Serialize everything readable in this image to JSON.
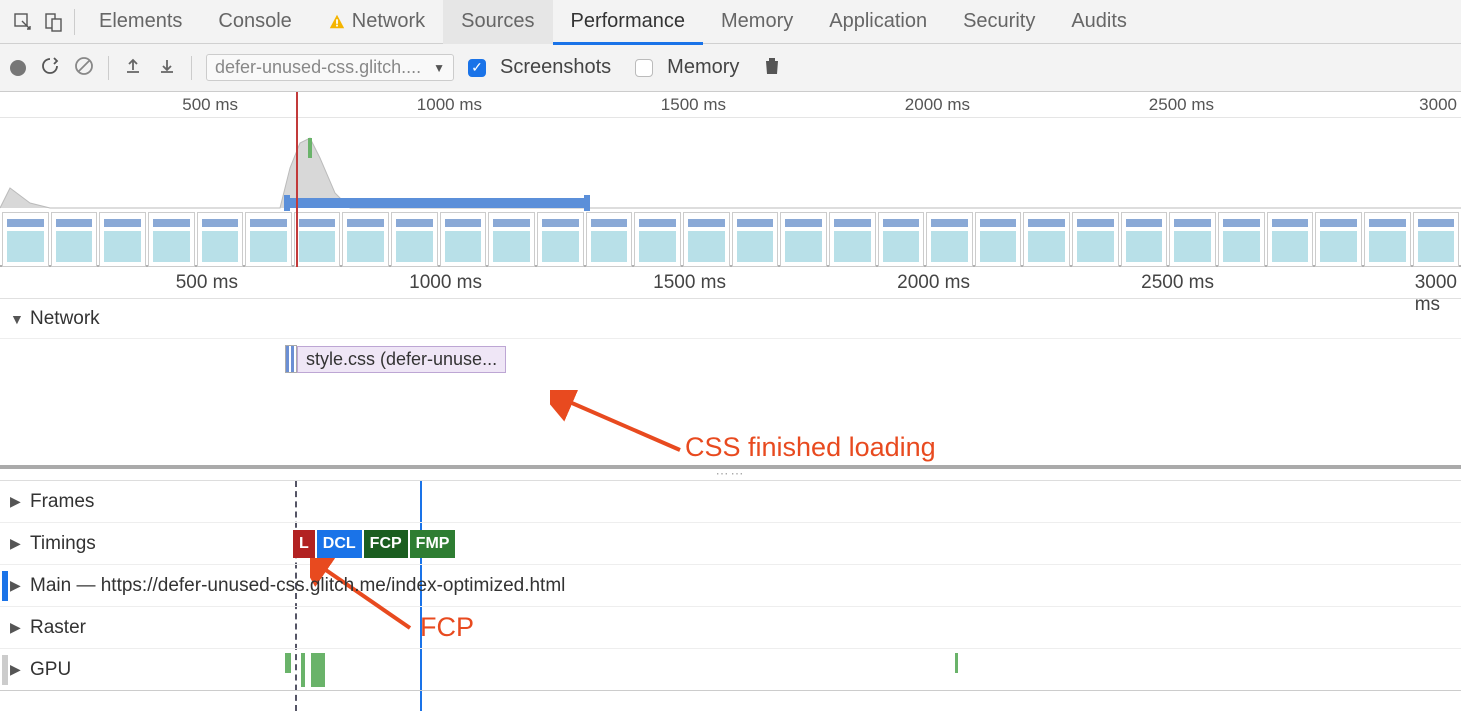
{
  "tabs": {
    "elements": "Elements",
    "console": "Console",
    "network": "Network",
    "sources": "Sources",
    "performance": "Performance",
    "memory": "Memory",
    "application": "Application",
    "security": "Security",
    "audits": "Audits"
  },
  "toolbar": {
    "select_label": "defer-unused-css.glitch....",
    "screenshots_label": "Screenshots",
    "memory_label": "Memory"
  },
  "overview_ruler": {
    "t1": "500 ms",
    "t2": "1000 ms",
    "t3": "1500 ms",
    "t4": "2000 ms",
    "t5": "2500 ms",
    "t6": "3000"
  },
  "main_ruler": {
    "t1": "500 ms",
    "t2": "1000 ms",
    "t3": "1500 ms",
    "t4": "2000 ms",
    "t5": "2500 ms",
    "t6": "3000 ms"
  },
  "tracks": {
    "network": "Network",
    "frames": "Frames",
    "timings": "Timings",
    "main": "Main — https://defer-unused-css.glitch.me/index-optimized.html",
    "raster": "Raster",
    "gpu": "GPU"
  },
  "network_item": "style.css (defer-unuse...",
  "timings_badges": {
    "l": "L",
    "dcl": "DCL",
    "fcp": "FCP",
    "fmp": "FMP"
  },
  "annotations": {
    "css_loaded": "CSS finished loading",
    "fcp": "FCP"
  }
}
